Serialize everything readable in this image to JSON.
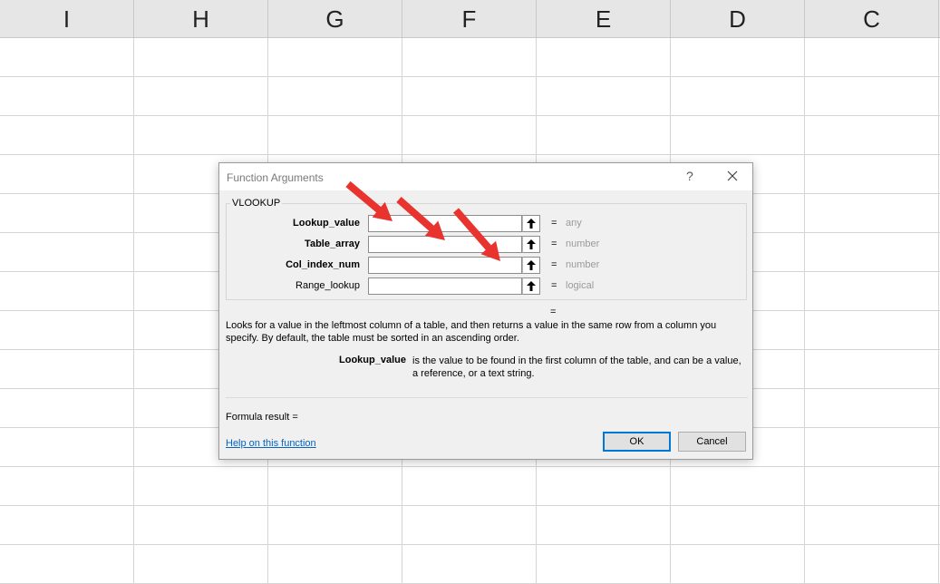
{
  "spreadsheet": {
    "columns": [
      "I",
      "H",
      "G",
      "F",
      "E",
      "D",
      "C"
    ]
  },
  "dialog": {
    "title": "Function Arguments",
    "help_glyph": "?",
    "function_name": "VLOOKUP",
    "arguments": [
      {
        "label": "Lookup_value",
        "bold": true,
        "value": "",
        "equals": "=",
        "type_hint": "any"
      },
      {
        "label": "Table_array",
        "bold": true,
        "value": "",
        "equals": "=",
        "type_hint": "number"
      },
      {
        "label": "Col_index_num",
        "bold": true,
        "value": "",
        "equals": "=",
        "type_hint": "number"
      },
      {
        "label": "Range_lookup",
        "bold": false,
        "value": "",
        "equals": "=",
        "type_hint": "logical"
      }
    ],
    "result_equals": "=",
    "description": "Looks for a value in the leftmost column of a table, and then returns a value in the same row from a column you specify. By default, the table must be sorted in an ascending order.",
    "arg_help_name": "Lookup_value",
    "arg_help_text": "is the value to be found in the first column of the table, and can be a value, a reference, or a text string.",
    "formula_result_label": "Formula result =",
    "help_link": "Help on this function",
    "ok_label": "OK",
    "cancel_label": "Cancel"
  },
  "annotation_color": "#e8332e"
}
